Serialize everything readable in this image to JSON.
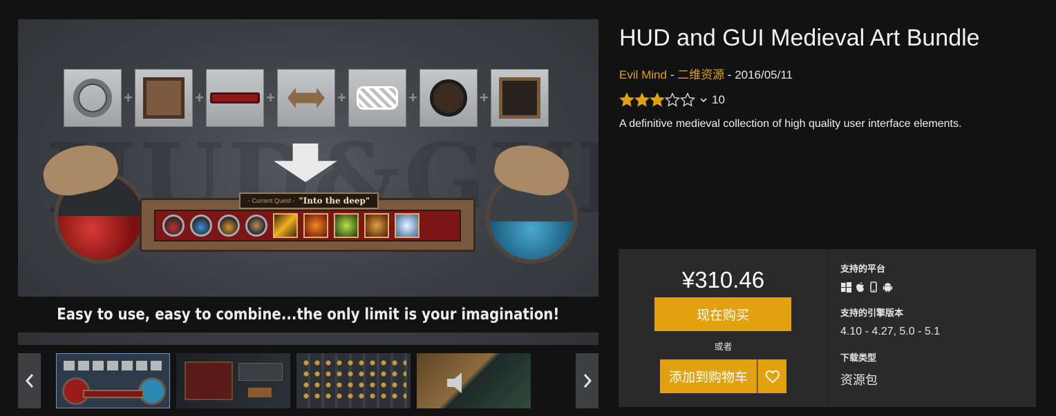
{
  "product": {
    "title": "HUD and GUI Medieval Art Bundle",
    "seller": "Evil Mind",
    "separator_1": " - ",
    "category": "二维资源",
    "separator_2": " - ",
    "date": "2016/05/11",
    "rating": 3,
    "max_rating": 5,
    "rating_count": "10",
    "description": "A definitive medieval collection of high quality user interface elements."
  },
  "hero": {
    "watermark": "HUD&GUI",
    "quest_label": "- Current Quest -",
    "quest_name": "\"Into the deep\"",
    "tagline": "Easy to use, easy to combine...the only limit is your imagination!",
    "health_fill": 0.52,
    "mana_fill": 0.45
  },
  "gallery": {
    "prev_icon": "chevron-left-icon",
    "next_icon": "chevron-right-icon",
    "thumbnail_count": 4,
    "selected_index": 0
  },
  "purchase": {
    "price": "¥310.46",
    "buy_label": "现在购买",
    "or_label": "或者",
    "cart_label": "添加到购物车",
    "wishlist_icon": "heart-icon",
    "accent_color": "#e2a20f"
  },
  "specs": {
    "platforms_label": "支持的平台",
    "platform_icons": [
      "windows-icon",
      "apple-icon",
      "mobile-icon",
      "android-icon"
    ],
    "engine_label": "支持的引擎版本",
    "engine_versions": "4.10 - 4.27, 5.0 - 5.1",
    "download_label": "下载类型",
    "download_type": "资源包"
  }
}
